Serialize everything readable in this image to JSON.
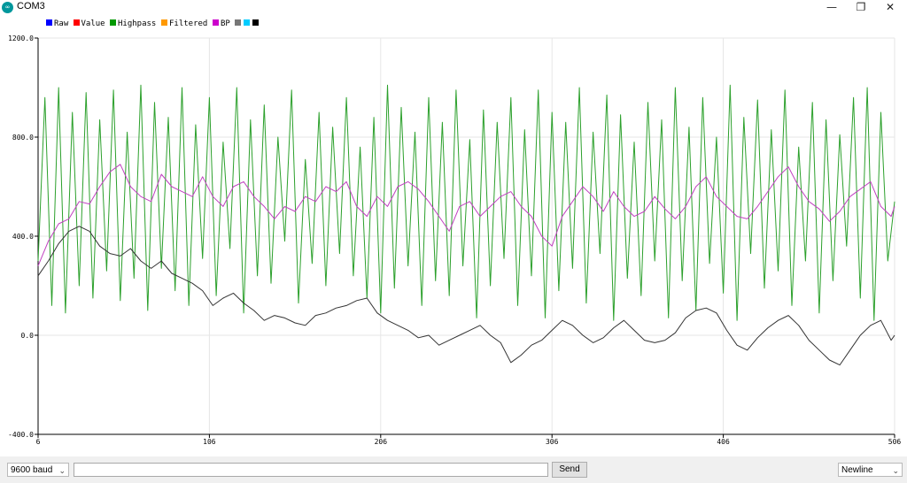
{
  "window": {
    "title": "COM3",
    "logo_text": "∞",
    "minimize_glyph": "—",
    "maximize_glyph": "❐",
    "close_glyph": "✕"
  },
  "legend": [
    {
      "label": "Raw",
      "color": "#0000ff"
    },
    {
      "label": "Value",
      "color": "#ff0000"
    },
    {
      "label": "Highpass",
      "color": "#009900"
    },
    {
      "label": "Filtered",
      "color": "#ff9900"
    },
    {
      "label": "BP",
      "color": "#cc00cc"
    },
    {
      "label": "",
      "color": "#777777"
    },
    {
      "label": "",
      "color": "#00ccff"
    },
    {
      "label": "",
      "color": "#000000"
    }
  ],
  "controls": {
    "baud_rate": "9600 baud",
    "send_value": "",
    "send_label": "Send",
    "line_ending": "Newline",
    "chevron_glyph": "⌄"
  },
  "chart_data": {
    "type": "line",
    "x_range": [
      6,
      506
    ],
    "y_range": [
      -400,
      1200
    ],
    "y_ticks": [
      "1200.0",
      "800.0",
      "400.0",
      "0.0",
      "-400.0"
    ],
    "x_ticks": [
      "6",
      "106",
      "206",
      "306",
      "406",
      "506"
    ],
    "grid": true,
    "legend_position": "top-left",
    "series": [
      {
        "name": "Highpass",
        "color": "#2ca02c",
        "points": [
          [
            6,
            300
          ],
          [
            10,
            960
          ],
          [
            14,
            120
          ],
          [
            18,
            1000
          ],
          [
            22,
            90
          ],
          [
            26,
            900
          ],
          [
            30,
            200
          ],
          [
            34,
            980
          ],
          [
            38,
            150
          ],
          [
            42,
            870
          ],
          [
            46,
            260
          ],
          [
            50,
            990
          ],
          [
            54,
            140
          ],
          [
            58,
            820
          ],
          [
            62,
            230
          ],
          [
            66,
            1010
          ],
          [
            70,
            100
          ],
          [
            74,
            940
          ],
          [
            78,
            270
          ],
          [
            82,
            880
          ],
          [
            86,
            180
          ],
          [
            90,
            1000
          ],
          [
            94,
            120
          ],
          [
            98,
            850
          ],
          [
            102,
            310
          ],
          [
            106,
            960
          ],
          [
            110,
            160
          ],
          [
            114,
            780
          ],
          [
            118,
            350
          ],
          [
            122,
            1000
          ],
          [
            126,
            90
          ],
          [
            130,
            870
          ],
          [
            134,
            240
          ],
          [
            138,
            930
          ],
          [
            142,
            210
          ],
          [
            146,
            800
          ],
          [
            150,
            380
          ],
          [
            154,
            990
          ],
          [
            158,
            130
          ],
          [
            162,
            710
          ],
          [
            166,
            290
          ],
          [
            170,
            900
          ],
          [
            174,
            200
          ],
          [
            178,
            840
          ],
          [
            182,
            330
          ],
          [
            186,
            960
          ],
          [
            190,
            240
          ],
          [
            194,
            760
          ],
          [
            198,
            150
          ],
          [
            202,
            880
          ],
          [
            206,
            90
          ],
          [
            210,
            1010
          ],
          [
            214,
            190
          ],
          [
            218,
            920
          ],
          [
            222,
            280
          ],
          [
            226,
            820
          ],
          [
            230,
            120
          ],
          [
            234,
            960
          ],
          [
            238,
            220
          ],
          [
            242,
            860
          ],
          [
            246,
            160
          ],
          [
            250,
            990
          ],
          [
            254,
            280
          ],
          [
            258,
            790
          ],
          [
            262,
            70
          ],
          [
            266,
            910
          ],
          [
            270,
            200
          ],
          [
            274,
            860
          ],
          [
            278,
            310
          ],
          [
            282,
            960
          ],
          [
            286,
            120
          ],
          [
            290,
            830
          ],
          [
            294,
            240
          ],
          [
            298,
            990
          ],
          [
            302,
            70
          ],
          [
            306,
            900
          ],
          [
            310,
            180
          ],
          [
            314,
            860
          ],
          [
            318,
            270
          ],
          [
            322,
            1000
          ],
          [
            326,
            130
          ],
          [
            330,
            820
          ],
          [
            334,
            330
          ],
          [
            338,
            970
          ],
          [
            342,
            60
          ],
          [
            346,
            890
          ],
          [
            350,
            230
          ],
          [
            354,
            780
          ],
          [
            358,
            160
          ],
          [
            362,
            940
          ],
          [
            366,
            300
          ],
          [
            370,
            870
          ],
          [
            374,
            70
          ],
          [
            378,
            1000
          ],
          [
            382,
            220
          ],
          [
            386,
            840
          ],
          [
            390,
            100
          ],
          [
            394,
            960
          ],
          [
            398,
            290
          ],
          [
            402,
            800
          ],
          [
            406,
            170
          ],
          [
            410,
            1010
          ],
          [
            414,
            60
          ],
          [
            418,
            880
          ],
          [
            422,
            330
          ],
          [
            426,
            950
          ],
          [
            430,
            190
          ],
          [
            434,
            830
          ],
          [
            438,
            260
          ],
          [
            442,
            990
          ],
          [
            446,
            120
          ],
          [
            450,
            760
          ],
          [
            454,
            300
          ],
          [
            458,
            940
          ],
          [
            462,
            90
          ],
          [
            466,
            870
          ],
          [
            470,
            220
          ],
          [
            474,
            810
          ],
          [
            478,
            360
          ],
          [
            482,
            960
          ],
          [
            486,
            150
          ],
          [
            490,
            1000
          ],
          [
            494,
            60
          ],
          [
            498,
            900
          ],
          [
            502,
            300
          ],
          [
            506,
            540
          ]
        ]
      },
      {
        "name": "BP",
        "color": "#c040c0",
        "points": [
          [
            6,
            280
          ],
          [
            12,
            380
          ],
          [
            18,
            450
          ],
          [
            24,
            470
          ],
          [
            30,
            540
          ],
          [
            36,
            530
          ],
          [
            42,
            600
          ],
          [
            48,
            660
          ],
          [
            54,
            690
          ],
          [
            60,
            600
          ],
          [
            66,
            560
          ],
          [
            72,
            540
          ],
          [
            78,
            650
          ],
          [
            84,
            600
          ],
          [
            90,
            580
          ],
          [
            96,
            560
          ],
          [
            102,
            640
          ],
          [
            108,
            560
          ],
          [
            114,
            520
          ],
          [
            120,
            600
          ],
          [
            126,
            620
          ],
          [
            132,
            560
          ],
          [
            138,
            520
          ],
          [
            144,
            470
          ],
          [
            150,
            520
          ],
          [
            156,
            500
          ],
          [
            162,
            560
          ],
          [
            168,
            540
          ],
          [
            174,
            600
          ],
          [
            180,
            580
          ],
          [
            186,
            620
          ],
          [
            192,
            520
          ],
          [
            198,
            480
          ],
          [
            204,
            560
          ],
          [
            210,
            520
          ],
          [
            216,
            600
          ],
          [
            222,
            620
          ],
          [
            228,
            590
          ],
          [
            234,
            540
          ],
          [
            240,
            480
          ],
          [
            246,
            420
          ],
          [
            252,
            520
          ],
          [
            258,
            540
          ],
          [
            264,
            480
          ],
          [
            270,
            520
          ],
          [
            276,
            560
          ],
          [
            282,
            580
          ],
          [
            288,
            520
          ],
          [
            294,
            480
          ],
          [
            300,
            400
          ],
          [
            306,
            360
          ],
          [
            312,
            480
          ],
          [
            318,
            540
          ],
          [
            324,
            600
          ],
          [
            330,
            560
          ],
          [
            336,
            500
          ],
          [
            342,
            580
          ],
          [
            348,
            520
          ],
          [
            354,
            480
          ],
          [
            360,
            500
          ],
          [
            366,
            560
          ],
          [
            372,
            510
          ],
          [
            378,
            470
          ],
          [
            384,
            520
          ],
          [
            390,
            600
          ],
          [
            396,
            640
          ],
          [
            402,
            560
          ],
          [
            408,
            520
          ],
          [
            414,
            480
          ],
          [
            420,
            470
          ],
          [
            426,
            520
          ],
          [
            432,
            580
          ],
          [
            438,
            640
          ],
          [
            444,
            680
          ],
          [
            450,
            600
          ],
          [
            456,
            540
          ],
          [
            462,
            510
          ],
          [
            468,
            460
          ],
          [
            474,
            500
          ],
          [
            480,
            560
          ],
          [
            486,
            590
          ],
          [
            492,
            620
          ],
          [
            498,
            520
          ],
          [
            504,
            480
          ],
          [
            506,
            520
          ]
        ]
      },
      {
        "name": "Filtered",
        "color": "#333333",
        "points": [
          [
            6,
            240
          ],
          [
            12,
            300
          ],
          [
            18,
            370
          ],
          [
            24,
            420
          ],
          [
            30,
            440
          ],
          [
            36,
            420
          ],
          [
            42,
            360
          ],
          [
            48,
            330
          ],
          [
            54,
            320
          ],
          [
            60,
            350
          ],
          [
            66,
            300
          ],
          [
            72,
            270
          ],
          [
            78,
            300
          ],
          [
            84,
            250
          ],
          [
            90,
            230
          ],
          [
            96,
            210
          ],
          [
            102,
            180
          ],
          [
            108,
            120
          ],
          [
            114,
            150
          ],
          [
            120,
            170
          ],
          [
            126,
            130
          ],
          [
            132,
            100
          ],
          [
            138,
            60
          ],
          [
            144,
            80
          ],
          [
            150,
            70
          ],
          [
            156,
            50
          ],
          [
            162,
            40
          ],
          [
            168,
            80
          ],
          [
            174,
            90
          ],
          [
            180,
            110
          ],
          [
            186,
            120
          ],
          [
            192,
            140
          ],
          [
            198,
            150
          ],
          [
            204,
            90
          ],
          [
            210,
            60
          ],
          [
            216,
            40
          ],
          [
            222,
            20
          ],
          [
            228,
            -10
          ],
          [
            234,
            0
          ],
          [
            240,
            -40
          ],
          [
            246,
            -20
          ],
          [
            252,
            0
          ],
          [
            258,
            20
          ],
          [
            264,
            40
          ],
          [
            270,
            0
          ],
          [
            276,
            -30
          ],
          [
            282,
            -110
          ],
          [
            288,
            -80
          ],
          [
            294,
            -40
          ],
          [
            300,
            -20
          ],
          [
            306,
            20
          ],
          [
            312,
            60
          ],
          [
            318,
            40
          ],
          [
            324,
            0
          ],
          [
            330,
            -30
          ],
          [
            336,
            -10
          ],
          [
            342,
            30
          ],
          [
            348,
            60
          ],
          [
            354,
            20
          ],
          [
            360,
            -20
          ],
          [
            366,
            -30
          ],
          [
            372,
            -20
          ],
          [
            378,
            10
          ],
          [
            384,
            70
          ],
          [
            390,
            100
          ],
          [
            396,
            110
          ],
          [
            402,
            90
          ],
          [
            408,
            20
          ],
          [
            414,
            -40
          ],
          [
            420,
            -60
          ],
          [
            426,
            -10
          ],
          [
            432,
            30
          ],
          [
            438,
            60
          ],
          [
            444,
            80
          ],
          [
            450,
            40
          ],
          [
            456,
            -20
          ],
          [
            462,
            -60
          ],
          [
            468,
            -100
          ],
          [
            474,
            -120
          ],
          [
            480,
            -60
          ],
          [
            486,
            0
          ],
          [
            492,
            40
          ],
          [
            498,
            60
          ],
          [
            504,
            -20
          ],
          [
            506,
            0
          ]
        ]
      }
    ]
  }
}
